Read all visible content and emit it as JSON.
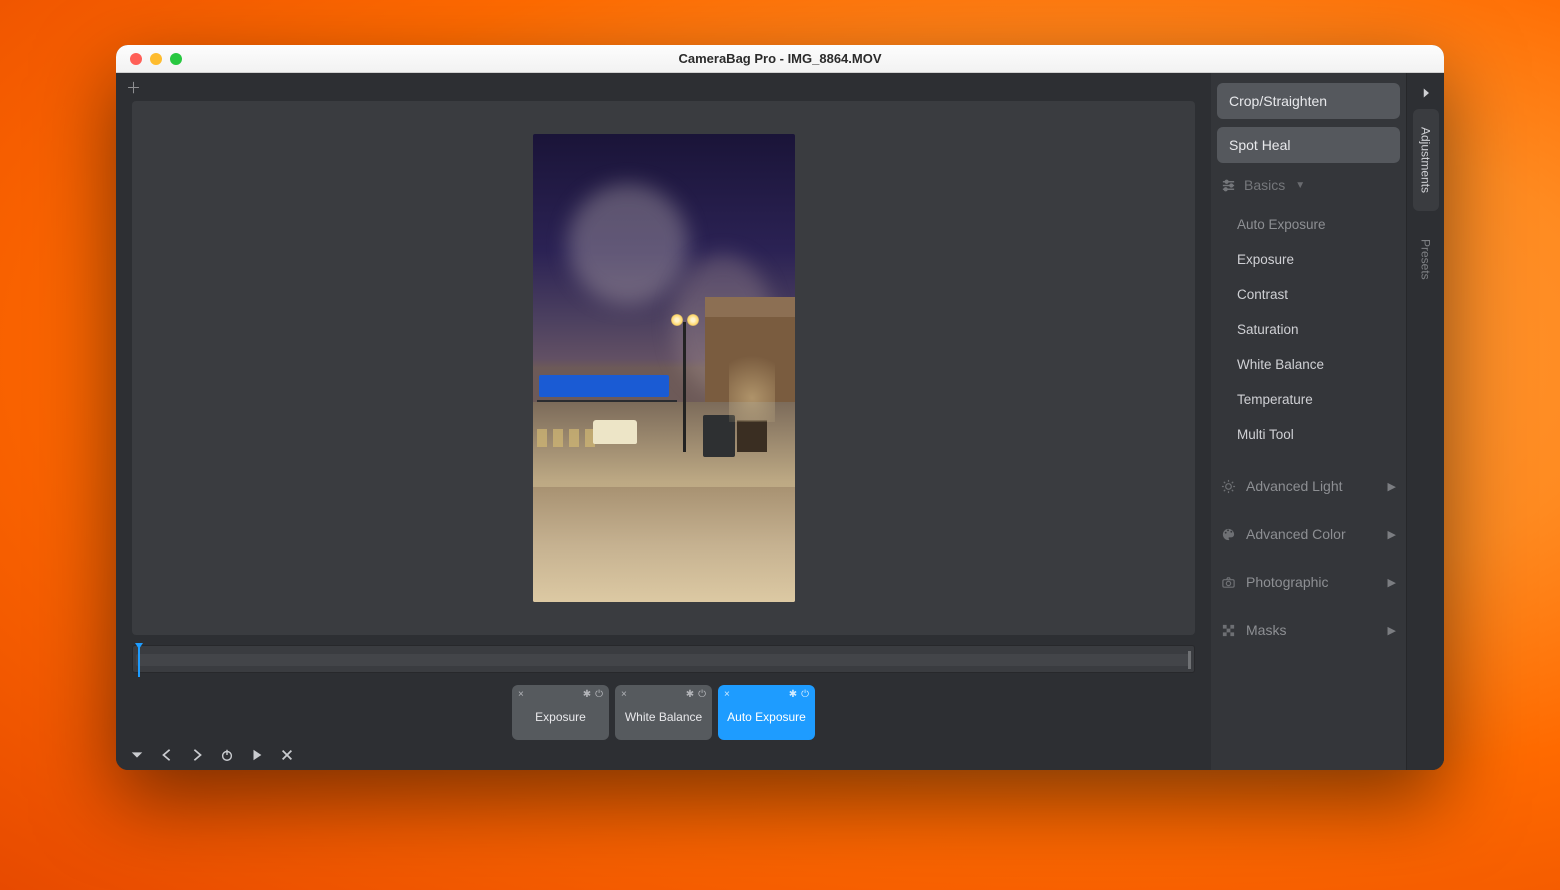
{
  "window": {
    "title": "CameraBag Pro - IMG_8864.MOV"
  },
  "panel": {
    "buttons": {
      "crop": "Crop/Straighten",
      "spot": "Spot Heal"
    },
    "basics": {
      "label": "Basics",
      "items": {
        "auto_exposure": "Auto Exposure",
        "exposure": "Exposure",
        "contrast": "Contrast",
        "saturation": "Saturation",
        "white_balance": "White Balance",
        "temperature": "Temperature",
        "multi_tool": "Multi Tool"
      }
    },
    "categories": {
      "advanced_light": "Advanced Light",
      "advanced_color": "Advanced Color",
      "photographic": "Photographic",
      "masks": "Masks"
    }
  },
  "edge_tabs": {
    "adjustments": "Adjustments",
    "presets": "Presets"
  },
  "chips": {
    "exposure": "Exposure",
    "white_balance": "White Balance",
    "auto_exposure": "Auto Exposure"
  },
  "icons": {
    "pin": "✱",
    "power": "⏻",
    "close": "×"
  }
}
